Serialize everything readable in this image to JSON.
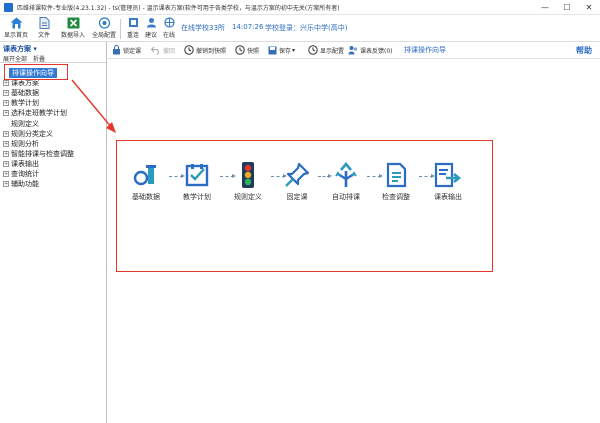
{
  "window": {
    "title": "匹维排课软件-专业版(4.23.1.32) - ts(管理员) - 温示课表方案(软件可用于各类学校，与温示方案的初中无关(方案所有者)"
  },
  "toolbar": {
    "buttons": [
      {
        "label": "显示首页",
        "icon": "home-icon"
      },
      {
        "label": "文件",
        "icon": "file-icon"
      },
      {
        "label": "数据导入",
        "icon": "excel-import-icon"
      },
      {
        "label": "全局配置",
        "icon": "global-config-icon"
      },
      {
        "label": "重连",
        "icon": "reconnect-icon"
      },
      {
        "label": "建议",
        "icon": "suggest-icon"
      },
      {
        "label": "在线",
        "icon": "online-icon"
      }
    ],
    "online_school": "在线学校33所",
    "time": "14:07:26",
    "login_school": "学校登录：兴乐中学(高中)"
  },
  "left_pane": {
    "title": "课表方案",
    "sub_actions": [
      "展开全部",
      "折叠"
    ],
    "tree": [
      {
        "label": "排课操作向导",
        "type": "selected"
      },
      {
        "label": "课表方案",
        "type": "expand"
      },
      {
        "label": "基础数据",
        "type": "expand"
      },
      {
        "label": "教学计划",
        "type": "expand"
      },
      {
        "label": "选科走班教学计划",
        "type": "expand"
      },
      {
        "label": "规则定义",
        "type": "leaf"
      },
      {
        "label": "规则分类定义",
        "type": "expand"
      },
      {
        "label": "规则分析",
        "type": "expand"
      },
      {
        "label": "智能排课与检查调整",
        "type": "expand"
      },
      {
        "label": "课表输出",
        "type": "expand"
      },
      {
        "label": "查询统计",
        "type": "expand"
      },
      {
        "label": "辅助功能",
        "type": "expand"
      }
    ]
  },
  "right_toolbar": {
    "buttons": [
      {
        "label": "锁定课",
        "icon": "lock-icon",
        "disabled": false
      },
      {
        "label": "撤回",
        "icon": "undo-icon",
        "disabled": true
      },
      {
        "label": "撤销到快照",
        "icon": "restore-snapshot-icon",
        "disabled": false
      },
      {
        "label": "快照",
        "icon": "snapshot-icon",
        "disabled": false
      },
      {
        "label": "保存",
        "icon": "save-icon",
        "disabled": false
      },
      {
        "label": "显示配置",
        "icon": "display-config-icon",
        "disabled": false
      },
      {
        "label": "课表反馈(0)",
        "icon": "feedback-icon",
        "disabled": false
      }
    ],
    "wizard_link": "排课操作向导",
    "help": "帮助"
  },
  "wizard": {
    "steps": [
      {
        "label": "基础数据",
        "icon": "basic-data-icon"
      },
      {
        "label": "教学计划",
        "icon": "teaching-plan-icon"
      },
      {
        "label": "规则定义",
        "icon": "rule-definition-icon"
      },
      {
        "label": "固定课",
        "icon": "pin-icon"
      },
      {
        "label": "自动排课",
        "icon": "auto-schedule-icon"
      },
      {
        "label": "检查调整",
        "icon": "check-adjust-icon"
      },
      {
        "label": "课表输出",
        "icon": "timetable-output-icon"
      }
    ]
  },
  "colors": {
    "accent": "#2b6cc4",
    "highlight_red": "#e4362a",
    "selected_bg": "#3279d3",
    "icon_teal": "#2a9bbd",
    "icon_blue": "#2b6cc4"
  }
}
